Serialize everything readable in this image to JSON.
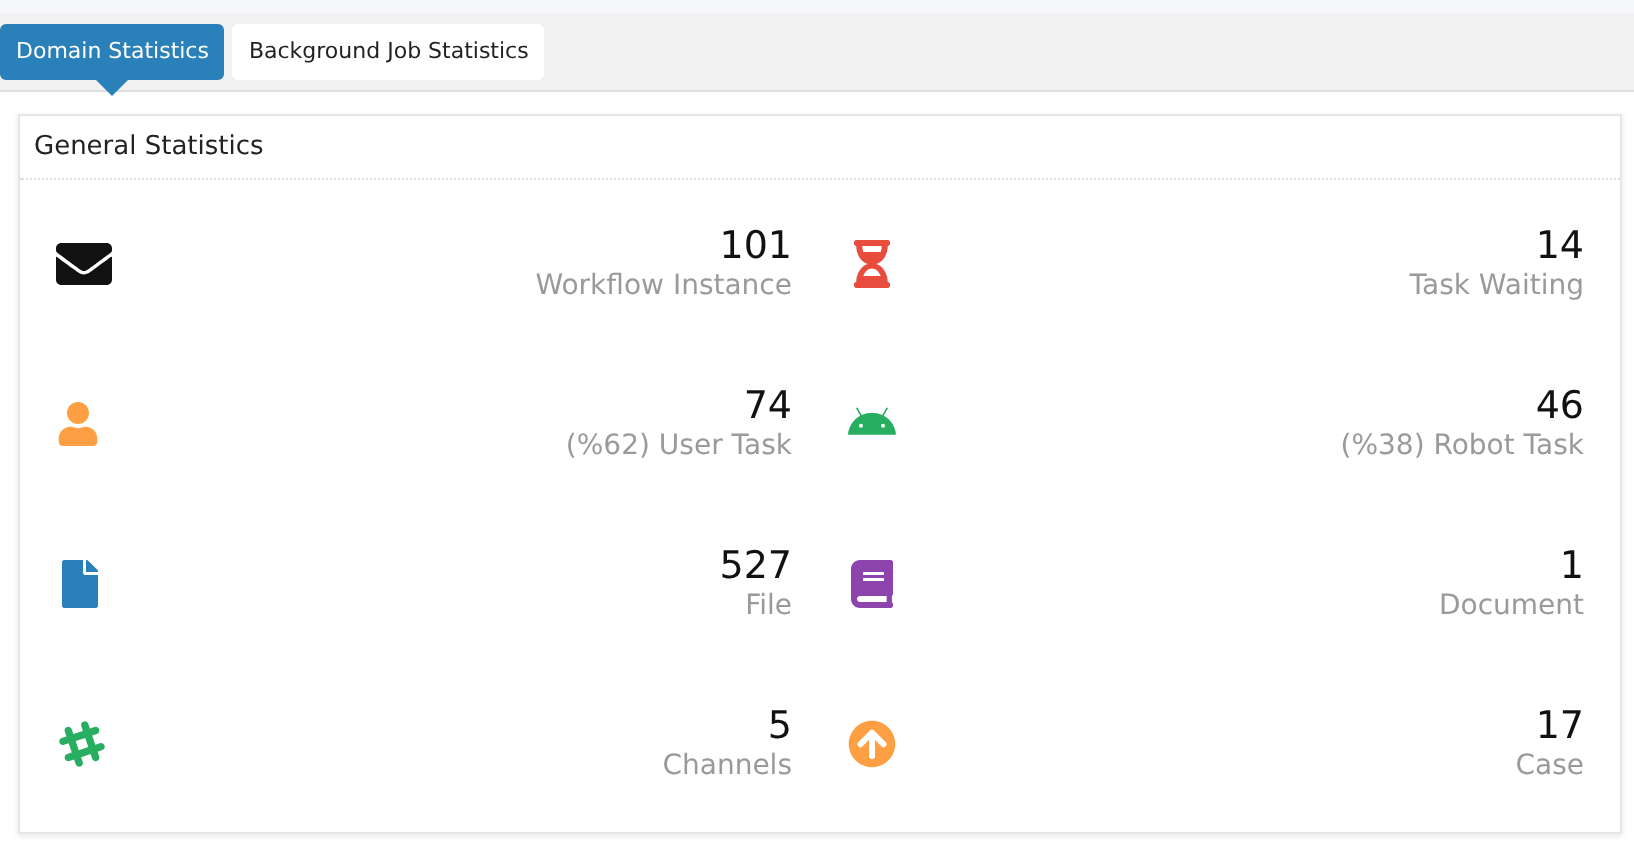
{
  "tabs": [
    {
      "label": "Domain Statistics",
      "selected": true
    },
    {
      "label": "Background Job Statistics",
      "selected": false
    }
  ],
  "card": {
    "title": "General Statistics",
    "stats": [
      {
        "kind": "envelope",
        "color": "#111111",
        "value": "101",
        "label": "Workflow Instance"
      },
      {
        "kind": "hourglass",
        "color": "#e74c3c",
        "value": "14",
        "label": "Task Waiting"
      },
      {
        "kind": "user",
        "color": "#ff9f43",
        "value": "74",
        "label": "(%62) User Task"
      },
      {
        "kind": "robot",
        "color": "#27ae60",
        "value": "46",
        "label": "(%38) Robot Task"
      },
      {
        "kind": "file",
        "color": "#2a80b9",
        "value": "527",
        "label": "File"
      },
      {
        "kind": "book",
        "color": "#8e44ad",
        "value": "1",
        "label": "Document"
      },
      {
        "kind": "hash",
        "color": "#27ae60",
        "value": "5",
        "label": "Channels"
      },
      {
        "kind": "arrow",
        "color": "#ff9f43",
        "value": "17",
        "label": "Case"
      }
    ]
  }
}
